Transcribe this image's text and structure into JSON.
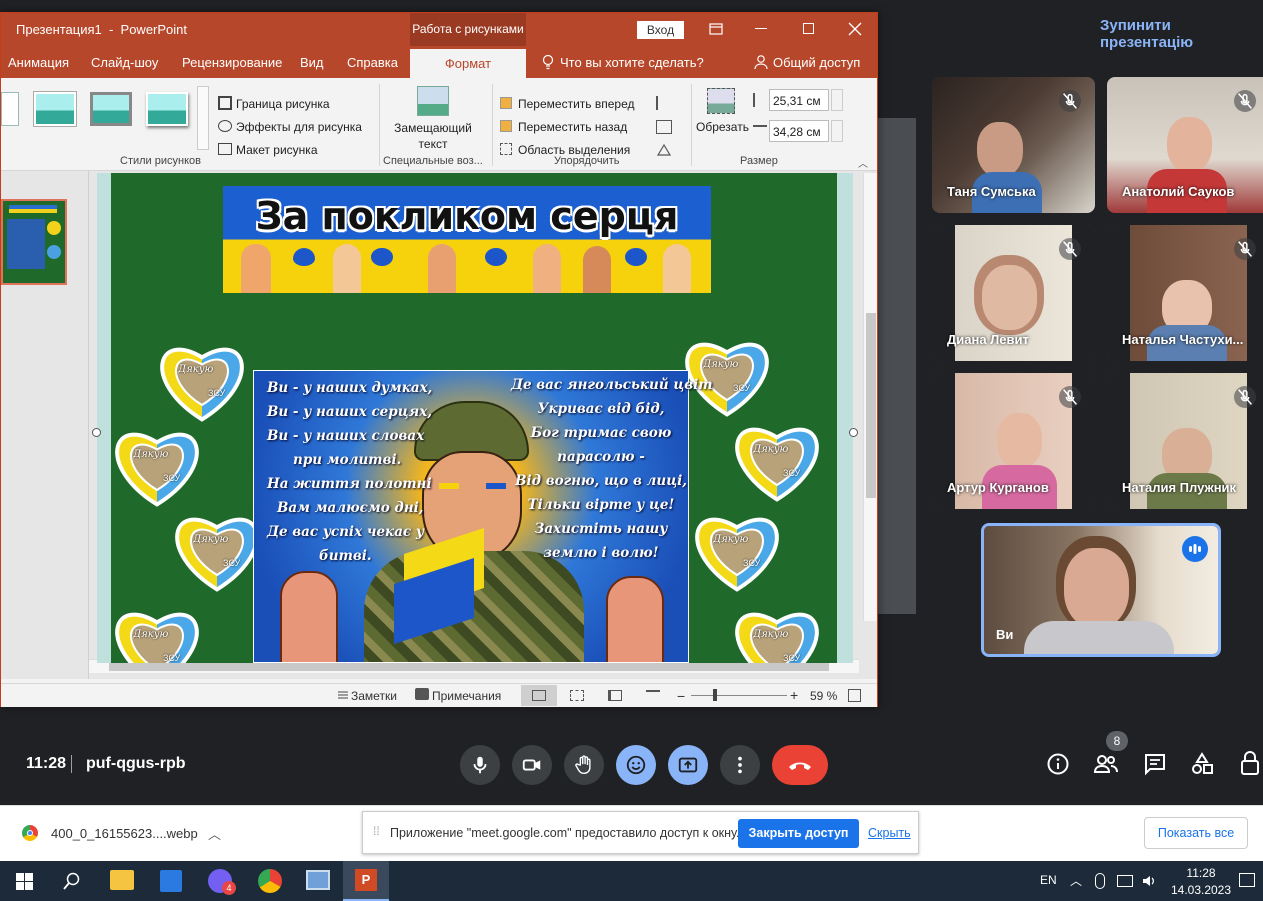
{
  "meet": {
    "stop_presentation": "Зупинити презентацію",
    "time": "11:28",
    "meeting_code": "puf-qgus-rpb",
    "people_count": "8",
    "participants": [
      {
        "name": "Таня Сумська"
      },
      {
        "name": "Анатолий Сауков"
      },
      {
        "name": "Диана Левит"
      },
      {
        "name": "Наталья Частухи..."
      },
      {
        "name": "Артур Курганов"
      },
      {
        "name": "Наталия Плужник"
      }
    ],
    "self_name": "Ви",
    "colors": {
      "bg": "#202124",
      "end_call": "#ea4335",
      "active": "#8ab4f8"
    }
  },
  "ppt": {
    "title": "Презентация1  -  PowerPoint",
    "context_tab": "Работа с рисунками",
    "sign_in": "Вход",
    "tabs": [
      "Анимация",
      "Слайд-шоу",
      "Рецензирование",
      "Вид",
      "Справка",
      "Формат"
    ],
    "tell_me": "Что вы хотите сделать?",
    "share": "Общий доступ",
    "ribbon": {
      "border": "Граница рисунка",
      "effects": "Эффекты для рисунка",
      "layout": "Макет рисунка",
      "styles_group": "Стили рисунков",
      "placeholder_text": "Замещающий текст",
      "accessibility_group": "Специальные воз...",
      "bring_forward": "Переместить вперед",
      "send_backward": "Переместить назад",
      "selection_pane": "Область выделения",
      "arrange_group": "Упорядочить",
      "crop": "Обрезать",
      "height": "25,31 см",
      "width": "34,28 см",
      "size_group": "Размер"
    },
    "status": {
      "notes": "Заметки",
      "comments": "Примечания",
      "zoom": "59 %"
    },
    "colors": {
      "accent": "#b7472a"
    }
  },
  "slide": {
    "banner_title": "За покликом серця",
    "heart_text_top": "Дякую",
    "heart_text_bottom": "ЗСУ",
    "poem_left": [
      "Ви - у наших думках,",
      "Ви - у наших серцях,",
      "Ви - у  наших словах",
      "при молитві.",
      "На життя полотні",
      "Вам малюємо дні,",
      "Де вас успіх чекає у",
      "битві."
    ],
    "poem_right": [
      "Де вас янгольський цвіт",
      "Укриває від бід,",
      "Бог тримає свою",
      "парасолю -",
      "Від вогню, що в лиці,",
      "Тільки вірте у це!",
      "Захистіть нашу",
      "землю і волю!"
    ]
  },
  "downloads": {
    "file": "400_0_16155623....webp",
    "share_notice": "Приложение \"meet.google.com\" предоставило доступ к окну.",
    "stop_sharing": "Закрыть доступ",
    "hide": "Скрыть",
    "show_all": "Показать все"
  },
  "taskbar": {
    "lang": "EN",
    "clock_time": "11:28",
    "clock_date": "14.03.2023",
    "viber_badge": "4"
  }
}
